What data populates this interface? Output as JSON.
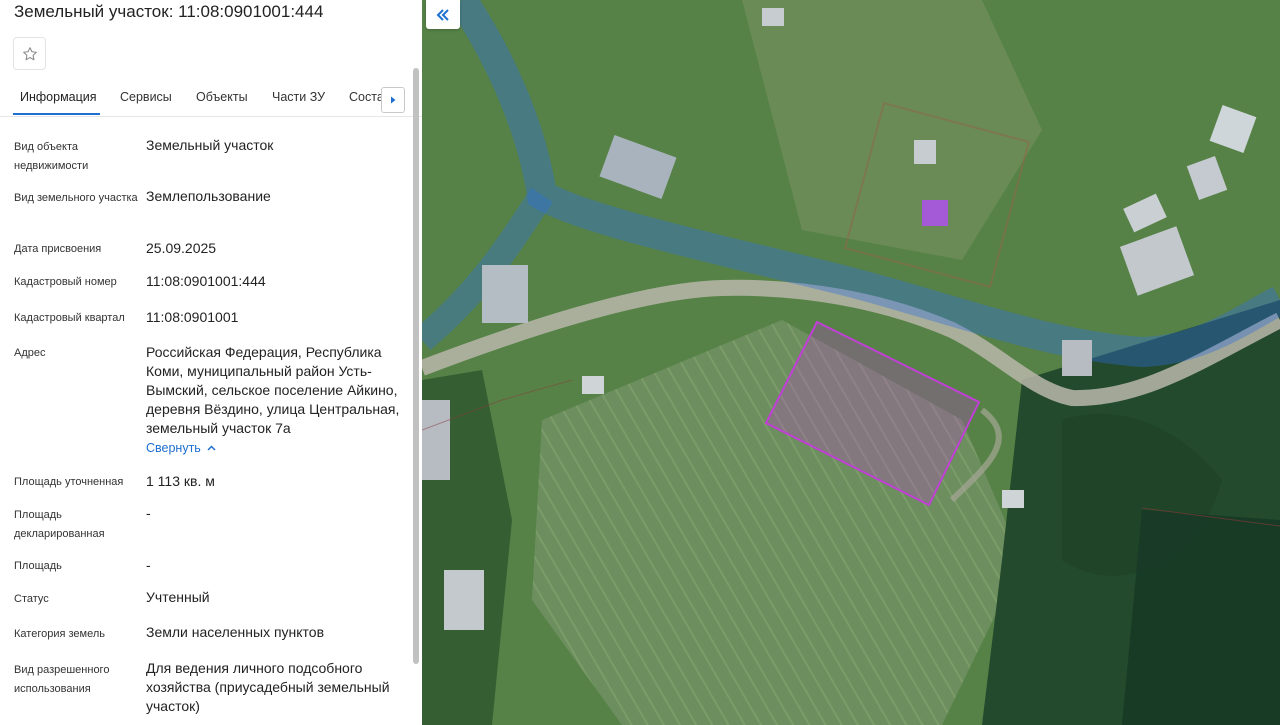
{
  "header": {
    "title": "Земельный участок: 11:08:0901001:444"
  },
  "tabs": [
    {
      "label": "Информация"
    },
    {
      "label": "Сервисы"
    },
    {
      "label": "Объекты"
    },
    {
      "label": "Части ЗУ"
    },
    {
      "label": "Соста"
    }
  ],
  "fields": [
    {
      "label": "Вид объекта недвижимости",
      "value": "Земельный участок"
    },
    {
      "label": "Вид земельного участка",
      "value": "Землепользование"
    },
    {
      "label": "Дата присвоения",
      "value": "25.09.2025"
    },
    {
      "label": "Кадастровый номер",
      "value": "11:08:0901001:444"
    },
    {
      "label": "Кадастровый квартал",
      "value": "11:08:0901001"
    },
    {
      "label": "Адрес",
      "value": "Российская Федерация, Республика Коми, муниципальный район Усть-Вымский, сельское поселение Айкино, деревня Вёздино, улица Центральная, земельный участок 7а"
    },
    {
      "label": "Площадь уточненная",
      "value": "1 113 кв. м"
    },
    {
      "label": "Площадь декларированная",
      "value": "-"
    },
    {
      "label": "Площадь",
      "value": "-"
    },
    {
      "label": "Статус",
      "value": "Учтенный"
    },
    {
      "label": "Категория земель",
      "value": "Земли населенных пунктов"
    },
    {
      "label": "Вид разрешенного использования",
      "value": "Для ведения личного подсобного хозяйства (приусадебный земельный участок)"
    }
  ],
  "address_toggle": {
    "label": "Свернуть"
  },
  "icons": {
    "favorite": "star-outline-icon",
    "tab_next": "caret-right-icon",
    "collapse_panel": "double-chevron-left-icon",
    "toggle": "chevron-up-icon"
  },
  "colors": {
    "accent": "#1e6fd0",
    "parcel_outline": "#c13fd6",
    "road_overlay": "#2f6ee0"
  }
}
